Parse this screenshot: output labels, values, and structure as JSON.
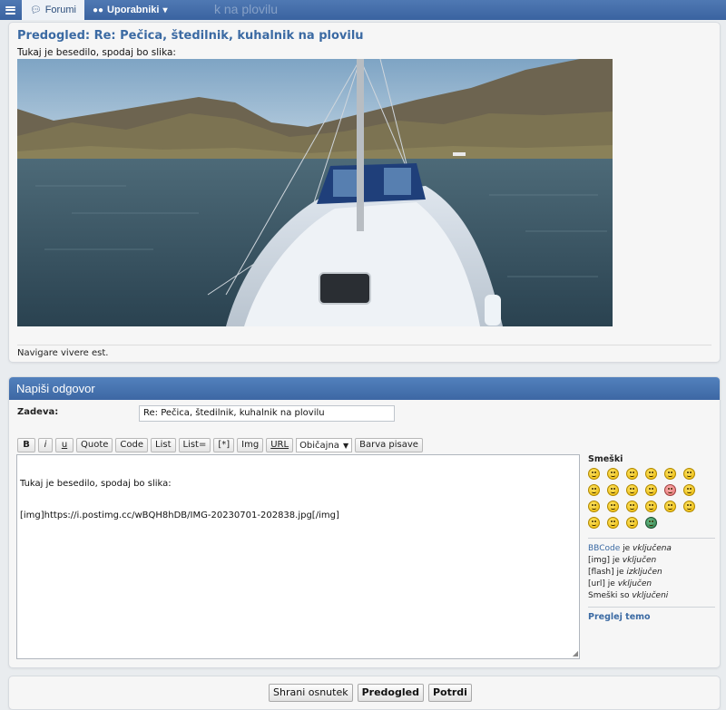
{
  "nav": {
    "forum_label": "Forumi",
    "users_label": "Uporabniki",
    "ghost_title": "k na plovilu"
  },
  "preview": {
    "title": "Predogled: Re: Pečica, štedilnik, kuhalnik na plovilu",
    "text": "Tukaj je besedilo, spodaj bo slika:",
    "signature": "Navigare vivere est."
  },
  "reply": {
    "header": "Napiši odgovor",
    "subject_label": "Zadeva:",
    "subject_value": "Re: Pečica, štedilnik, kuhalnik na plovilu",
    "toolbar": {
      "bold": "B",
      "italic": "i",
      "underline": "u",
      "quote": "Quote",
      "code": "Code",
      "list": "List",
      "list_eq": "List=",
      "list_item": "[*]",
      "img": "Img",
      "url": "URL",
      "font_size": "Običajna",
      "font_color": "Barva pisave"
    },
    "editor_lines": [
      "Tukaj je besedilo, spodaj bo slika:",
      "[img]https://i.postimg.cc/wBQH8hDB/IMG-20230701-202838.jpg[/img]"
    ],
    "smilies_title": "Smeški",
    "status": {
      "bbcode_link": "BBCode",
      "bbcode_rest": " je ",
      "bbcode_state": "vključena",
      "img_prefix": "[img] je ",
      "img_state": "vključen",
      "flash_prefix": "[flash] je ",
      "flash_state": "izključen",
      "url_prefix": "[url] je ",
      "url_state": "vključen",
      "smilies_prefix": "Smeški so ",
      "smilies_state": "vključeni"
    },
    "review_link": "Preglej temo"
  },
  "actions": {
    "save_draft": "Shrani osnutek",
    "preview": "Predogled",
    "submit": "Potrdi"
  },
  "colors": {
    "navbar": "#3a63a0",
    "accent": "#3b6aa3",
    "panel_bg": "#f6f6f6"
  }
}
